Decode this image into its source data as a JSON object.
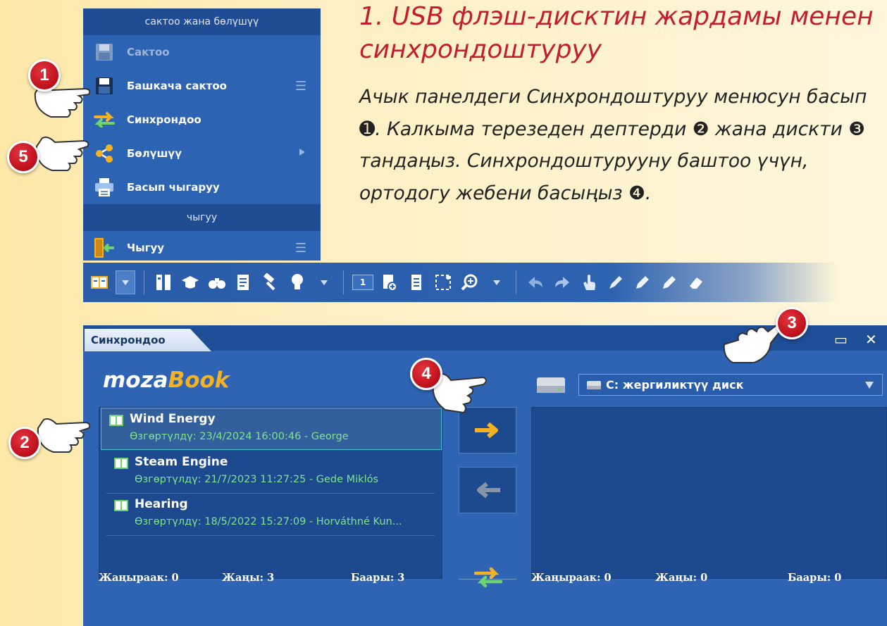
{
  "menu": {
    "section_top": "сактоо жана бөлүшүү",
    "items": [
      {
        "label": "Сактоо",
        "icon": "floppy-disk-icon",
        "disabled": true
      },
      {
        "label": "Башкача сактоо",
        "icon": "floppy-disk-icon"
      },
      {
        "label": "Синхрондоо",
        "icon": "sync-arrows-icon"
      },
      {
        "label": "Бөлүшүү",
        "icon": "share-icon"
      },
      {
        "label": "Басып чыгаруу",
        "icon": "printer-icon"
      }
    ],
    "section_bottom": "чыгуу",
    "exit_label": "Чыгуу"
  },
  "toolbar": {
    "page_number": "1"
  },
  "instructions": {
    "title": "1. USB флэш-дисктин жардамы менен синхрондоштуруу",
    "body": "Ачык панелдеги Синхрондоштуруу менюсун басып ➊. Калкыма терезеден дептерди ❷ жана дискти ❸ тандаңыз. Синхрондоштурууну баштоо үчүн, ортодогу жебени басыңыз ❹."
  },
  "badges": [
    "1",
    "5",
    "2",
    "3",
    "4"
  ],
  "dialog": {
    "tab_title": "Синхрондоо",
    "brand_part1": "moza",
    "brand_part2": "Book",
    "books": [
      {
        "title": "Wind Energy",
        "meta": "Өзгөртүлдү: 23/4/2024 16:00:46 - George",
        "selected": true
      },
      {
        "title": "Steam Engine",
        "meta": "Өзгөртүлдү: 21/7/2023 11:27:25 - Gede Miklós"
      },
      {
        "title": "Hearing",
        "meta": "Өзгөртүлдү: 18/5/2022 15:27:09 - Horváthné Kun..."
      }
    ],
    "drive": "C: жергиликтүү диск",
    "left_stats": {
      "newer": "Жаңыраак: 0",
      "new": "Жаңы: 3",
      "all": "Баары: 3"
    },
    "right_stats": {
      "newer": "Жаңыраак: 0",
      "new": "Жаңы: 0",
      "all": "Баары: 0"
    }
  },
  "colors": {
    "accent_red": "#c41e2e",
    "panel_blue": "#2e64b3",
    "meta_green": "#7fe38c",
    "arrow_yellow": "#f5b324"
  }
}
